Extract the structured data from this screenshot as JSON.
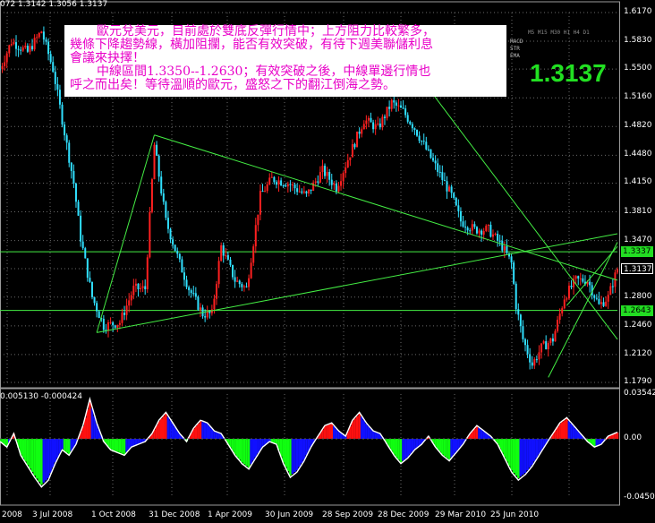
{
  "header": {
    "ohlc": "072 1.3142 1.3056 1.3137"
  },
  "annotation": {
    "lines": [
      "歐元兌美元，目前處於雙底反彈行情中；上方阻力比較繁多，",
      "幾條下降趨勢線，橫加阻攔，能否有效突破，有待下週美聯儲利息",
      "會議來抉擇！",
      "中線區間1.3350--1.2630；有效突破之後，中線單邊行情也",
      "呼之而出矣！等待溫順的歐元，盛怒之下的翻江倒海之勢。"
    ]
  },
  "panel": {
    "current_price": "1.3137",
    "timeframes": [
      "M5",
      "M15",
      "M30",
      "H1",
      "H4",
      "D1"
    ],
    "indicators": [
      "MACD",
      "STR",
      "EMA"
    ]
  },
  "price_axis": {
    "ticks": [
      "1.6170",
      "1.5830",
      "1.5500",
      "1.5160",
      "1.4820",
      "1.4480",
      "1.4150",
      "1.3810",
      "1.3470",
      "1.3137",
      "1.2800",
      "1.2460",
      "1.2120",
      "1.1790"
    ],
    "tags": [
      {
        "label": "1.3337",
        "value": 1.3337,
        "bg": "#22dd22",
        "fg": "#000000"
      },
      {
        "label": "1.3137",
        "value": 1.3137,
        "bg": "#000000",
        "fg": "#ffffff"
      },
      {
        "label": "1.2643",
        "value": 1.2643,
        "bg": "#22dd22",
        "fg": "#000000"
      }
    ]
  },
  "osc": {
    "label": "0.005130 -0.000424",
    "ticks": [
      "0.035427",
      "0.00",
      "-0.045098"
    ]
  },
  "time_axis": [
    "2008",
    "3 Jul 2008",
    "1 Oct 2008",
    "31 Dec 2008",
    "1 Apr 2009",
    "30 Jun 2009",
    "28 Sep 2009",
    "28 Dec 2009",
    "29 Mar 2010",
    "25 Jun 2010"
  ],
  "colors": {
    "bull": "#ff2020",
    "bear": "#30e0ff",
    "trend": "#44ee44",
    "grid": "#6a6a6a",
    "pos_hist": "#ff1010",
    "neg_hist": "#10ff10",
    "blue_hist": "#1010ff"
  },
  "chart_data": [
    {
      "type": "candlestick",
      "title": "",
      "ylim": [
        1.179,
        1.617
      ],
      "x": [
        "3 Jul 2008",
        "1 Oct 2008",
        "31 Dec 2008",
        "1 Apr 2009",
        "30 Jun 2009",
        "28 Sep 2009",
        "28 Dec 2009",
        "29 Mar 2010",
        "25 Jun 2010"
      ],
      "path": [
        [
          0,
          1.55
        ],
        [
          5,
          1.583
        ],
        [
          12,
          1.57
        ],
        [
          18,
          1.595
        ],
        [
          23,
          1.55
        ],
        [
          27,
          1.49
        ],
        [
          32,
          1.415
        ],
        [
          35,
          1.35
        ],
        [
          40,
          1.28
        ],
        [
          45,
          1.246
        ],
        [
          52,
          1.25
        ],
        [
          58,
          1.29
        ],
        [
          63,
          1.29
        ],
        [
          67,
          1.46
        ],
        [
          72,
          1.37
        ],
        [
          78,
          1.32
        ],
        [
          82,
          1.29
        ],
        [
          88,
          1.26
        ],
        [
          92,
          1.26
        ],
        [
          96,
          1.34
        ],
        [
          102,
          1.3
        ],
        [
          107,
          1.29
        ],
        [
          113,
          1.4
        ],
        [
          118,
          1.42
        ],
        [
          125,
          1.415
        ],
        [
          133,
          1.4
        ],
        [
          140,
          1.43
        ],
        [
          146,
          1.41
        ],
        [
          152,
          1.45
        ],
        [
          158,
          1.49
        ],
        [
          164,
          1.48
        ],
        [
          170,
          1.51
        ],
        [
          175,
          1.5
        ],
        [
          180,
          1.48
        ],
        [
          186,
          1.45
        ],
        [
          190,
          1.43
        ],
        [
          196,
          1.4
        ],
        [
          200,
          1.37
        ],
        [
          206,
          1.36
        ],
        [
          212,
          1.36
        ],
        [
          218,
          1.34
        ],
        [
          222,
          1.32
        ],
        [
          224,
          1.27
        ],
        [
          227,
          1.23
        ],
        [
          231,
          1.2
        ],
        [
          235,
          1.22
        ],
        [
          240,
          1.23
        ],
        [
          245,
          1.28
        ],
        [
          250,
          1.3
        ],
        [
          255,
          1.3
        ],
        [
          260,
          1.27
        ],
        [
          264,
          1.28
        ],
        [
          268,
          1.3137
        ]
      ],
      "horizontal_levels": [
        1.3337,
        1.2643
      ],
      "trend_lines": [
        [
          [
            42,
            1.238
          ],
          [
            268,
            1.355
          ]
        ],
        [
          [
            67,
            1.472
          ],
          [
            268,
            1.3
          ]
        ],
        [
          [
            42,
            1.238
          ],
          [
            67,
            1.472
          ]
        ],
        [
          [
            188,
            1.52
          ],
          [
            268,
            1.23
          ]
        ],
        [
          [
            238,
            1.185
          ],
          [
            268,
            1.345
          ]
        ],
        [
          [
            246,
            1.27
          ],
          [
            268,
            1.34
          ]
        ]
      ]
    },
    {
      "type": "bar",
      "title": "",
      "ylim": [
        -0.045098,
        0.035427
      ],
      "histogram": [
        [
          0,
          -0.002
        ],
        [
          3,
          -0.006
        ],
        [
          6,
          0.004
        ],
        [
          9,
          -0.012
        ],
        [
          12,
          -0.02
        ],
        [
          15,
          -0.028
        ],
        [
          18,
          -0.035
        ],
        [
          21,
          -0.03
        ],
        [
          24,
          -0.018
        ],
        [
          27,
          -0.008
        ],
        [
          30,
          -0.012
        ],
        [
          33,
          -0.004
        ],
        [
          36,
          0.01
        ],
        [
          39,
          0.03
        ],
        [
          42,
          0.012
        ],
        [
          45,
          -0.002
        ],
        [
          48,
          -0.008
        ],
        [
          51,
          -0.01
        ],
        [
          54,
          -0.012
        ],
        [
          57,
          -0.006
        ],
        [
          60,
          -0.004
        ],
        [
          63,
          -0.002
        ],
        [
          66,
          0.004
        ],
        [
          69,
          0.014
        ],
        [
          72,
          0.02
        ],
        [
          75,
          0.012
        ],
        [
          78,
          0.004
        ],
        [
          81,
          -0.002
        ],
        [
          84,
          0.008
        ],
        [
          87,
          0.014
        ],
        [
          90,
          0.012
        ],
        [
          93,
          0.006
        ],
        [
          96,
          0.004
        ],
        [
          99,
          -0.004
        ],
        [
          102,
          -0.012
        ],
        [
          105,
          -0.018
        ],
        [
          108,
          -0.022
        ],
        [
          111,
          -0.014
        ],
        [
          114,
          -0.006
        ],
        [
          117,
          -0.002
        ],
        [
          120,
          -0.004
        ],
        [
          123,
          -0.018
        ],
        [
          126,
          -0.028
        ],
        [
          129,
          -0.024
        ],
        [
          132,
          -0.016
        ],
        [
          135,
          -0.006
        ],
        [
          138,
          0.002
        ],
        [
          141,
          0.01
        ],
        [
          144,
          0.012
        ],
        [
          147,
          0.006
        ],
        [
          150,
          0.002
        ],
        [
          153,
          0.014
        ],
        [
          156,
          0.02
        ],
        [
          159,
          0.012
        ],
        [
          162,
          0.006
        ],
        [
          165,
          0.004
        ],
        [
          168,
          -0.004
        ],
        [
          171,
          -0.012
        ],
        [
          174,
          -0.018
        ],
        [
          177,
          -0.014
        ],
        [
          180,
          -0.008
        ],
        [
          183,
          -0.004
        ],
        [
          186,
          0.002
        ],
        [
          189,
          -0.006
        ],
        [
          192,
          -0.012
        ],
        [
          195,
          -0.016
        ],
        [
          198,
          -0.01
        ],
        [
          201,
          -0.004
        ],
        [
          204,
          0.004
        ],
        [
          207,
          0.01
        ],
        [
          210,
          0.006
        ],
        [
          213,
          0.002
        ],
        [
          216,
          -0.004
        ],
        [
          219,
          -0.014
        ],
        [
          222,
          -0.024
        ],
        [
          225,
          -0.03
        ],
        [
          228,
          -0.026
        ],
        [
          231,
          -0.02
        ],
        [
          234,
          -0.012
        ],
        [
          237,
          -0.004
        ],
        [
          240,
          0.004
        ],
        [
          243,
          0.012
        ],
        [
          246,
          0.016
        ],
        [
          249,
          0.01
        ],
        [
          252,
          0.004
        ],
        [
          255,
          -0.002
        ],
        [
          258,
          -0.006
        ],
        [
          261,
          -0.004
        ],
        [
          264,
          0.002
        ],
        [
          268,
          0.005
        ]
      ]
    }
  ]
}
